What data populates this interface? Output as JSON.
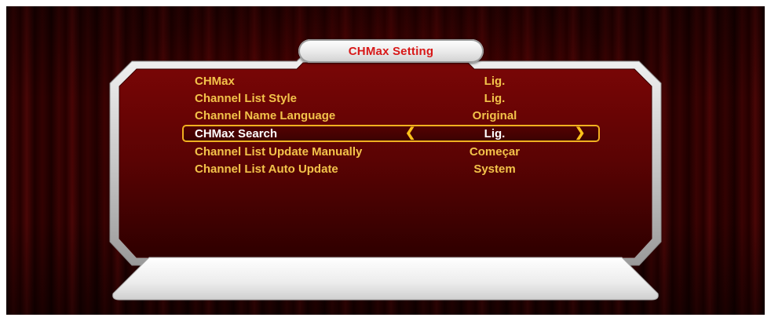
{
  "dialog": {
    "title": "CHMax Setting"
  },
  "menu": {
    "items": [
      {
        "label": "CHMax",
        "value": "Lig.",
        "selected": false
      },
      {
        "label": "Channel List Style",
        "value": "Lig.",
        "selected": false
      },
      {
        "label": "Channel Name Language",
        "value": "Original",
        "selected": false
      },
      {
        "label": "CHMax Search",
        "value": "Lig.",
        "selected": true
      },
      {
        "label": "Channel List Update Manually",
        "value": "Começar",
        "selected": false
      },
      {
        "label": "Channel List Auto Update",
        "value": "System",
        "selected": false
      }
    ],
    "arrow_left": "❮",
    "arrow_right": "❯"
  },
  "colors": {
    "item_text": "#f3c34a",
    "selected_text": "#ffffff",
    "selection_border": "#f0b020",
    "title_text": "#d81818"
  }
}
